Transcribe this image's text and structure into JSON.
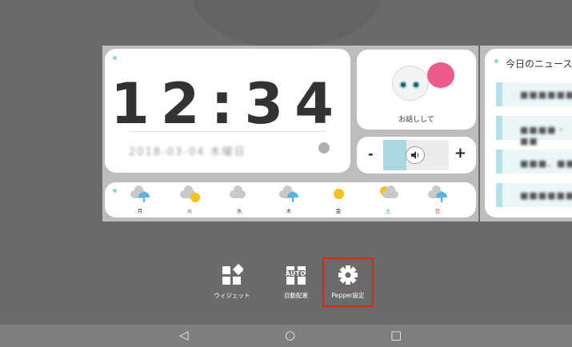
{
  "clock": {
    "time": "12:34",
    "date": "2018-03-04  木曜日"
  },
  "robot": {
    "label": "お話しして"
  },
  "volume": {
    "minus": "-",
    "plus": "+",
    "level": 0.35,
    "icon": "speaker-icon"
  },
  "weather": {
    "days": [
      {
        "label": "月",
        "icon": "cloud-umbrella",
        "color": "#333333"
      },
      {
        "label": "火",
        "icon": "cloud-sun",
        "color": "#333333"
      },
      {
        "label": "水",
        "icon": "cloud",
        "color": "#333333"
      },
      {
        "label": "木",
        "icon": "cloud-umbrella",
        "color": "#333333"
      },
      {
        "label": "金",
        "icon": "sun",
        "color": "#333333"
      },
      {
        "label": "土",
        "icon": "sun-cloud",
        "color": "#2a8fe0"
      },
      {
        "label": "日",
        "icon": "cloud-umbrella",
        "color": "#e0302a"
      }
    ]
  },
  "news": {
    "title": "今日のニュース",
    "items": [
      "■■■■■■■",
      "■■■■・■■",
      "■■■、■■",
      "■■■■■■■"
    ]
  },
  "dock": {
    "widget_label": "ウィジェット",
    "auto_label": "自動配置",
    "auto_badge": "AUTO",
    "settings_label": "Pepper設定"
  },
  "nav": {
    "back": "◁",
    "home": "○",
    "recent": "□"
  },
  "colors": {
    "accent": "#a8d8e0",
    "highlight": "#d8271c",
    "bubble": "#ef5a8a"
  }
}
